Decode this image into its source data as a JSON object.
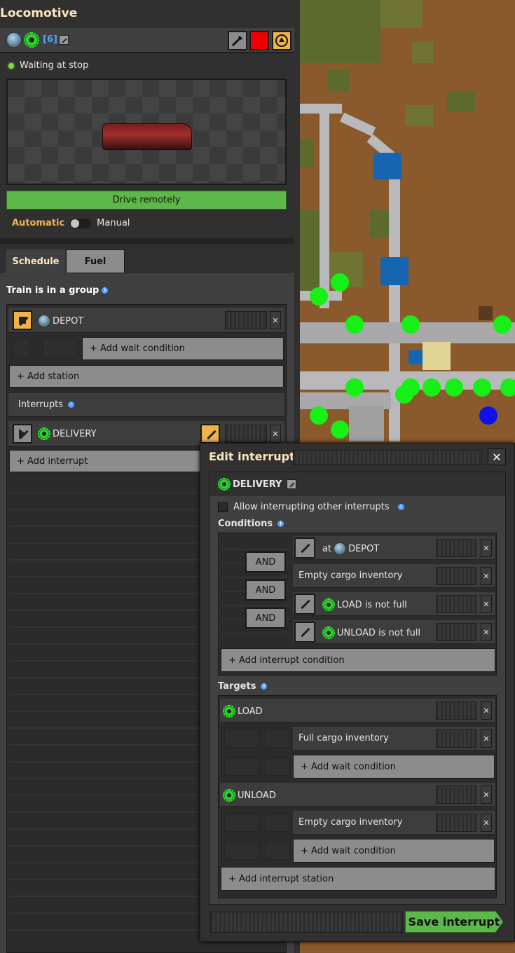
{
  "window": {
    "title": "Locomotive"
  },
  "toolbar": {
    "group_link": "[6]"
  },
  "status": {
    "text": "Waiting at stop"
  },
  "drive": {
    "label": "Drive remotely"
  },
  "mode": {
    "automatic": "Automatic",
    "manual": "Manual"
  },
  "tabs": {
    "schedule": "Schedule",
    "fuel": "Fuel"
  },
  "schedule": {
    "group_text": "Train is in a group",
    "station_name": "DEPOT",
    "add_wait": "+ Add wait condition",
    "add_station": "+ Add station",
    "interrupts_label": "Interrupts",
    "interrupt_name": "DELIVERY",
    "add_interrupt": "+ Add interrupt"
  },
  "dialog": {
    "title": "Edit interrupt",
    "interrupt_name": "DELIVERY",
    "allow_label": "Allow interrupting other interrupts",
    "conditions_label": "Conditions",
    "and_label": "AND",
    "conditions": {
      "c1_prefix": "at",
      "c1_station": "DEPOT",
      "c2": "Empty cargo inventory",
      "c3": "LOAD is not full",
      "c4": "UNLOAD is not full"
    },
    "add_condition": "+ Add interrupt condition",
    "targets_label": "Targets",
    "targets": {
      "t1_name": "LOAD",
      "t1_wait": "Full cargo inventory",
      "t1_add_wait": "+ Add wait condition",
      "t2_name": "UNLOAD",
      "t2_wait": "Empty cargo inventory",
      "t2_add_wait": "+ Add wait condition"
    },
    "add_station": "+ Add interrupt station",
    "save": "Save interrupt"
  },
  "colors": {
    "accent": "#f0b34a",
    "green_button": "#5db84a",
    "link": "#56a2ff",
    "title": "#ffe6c0"
  }
}
